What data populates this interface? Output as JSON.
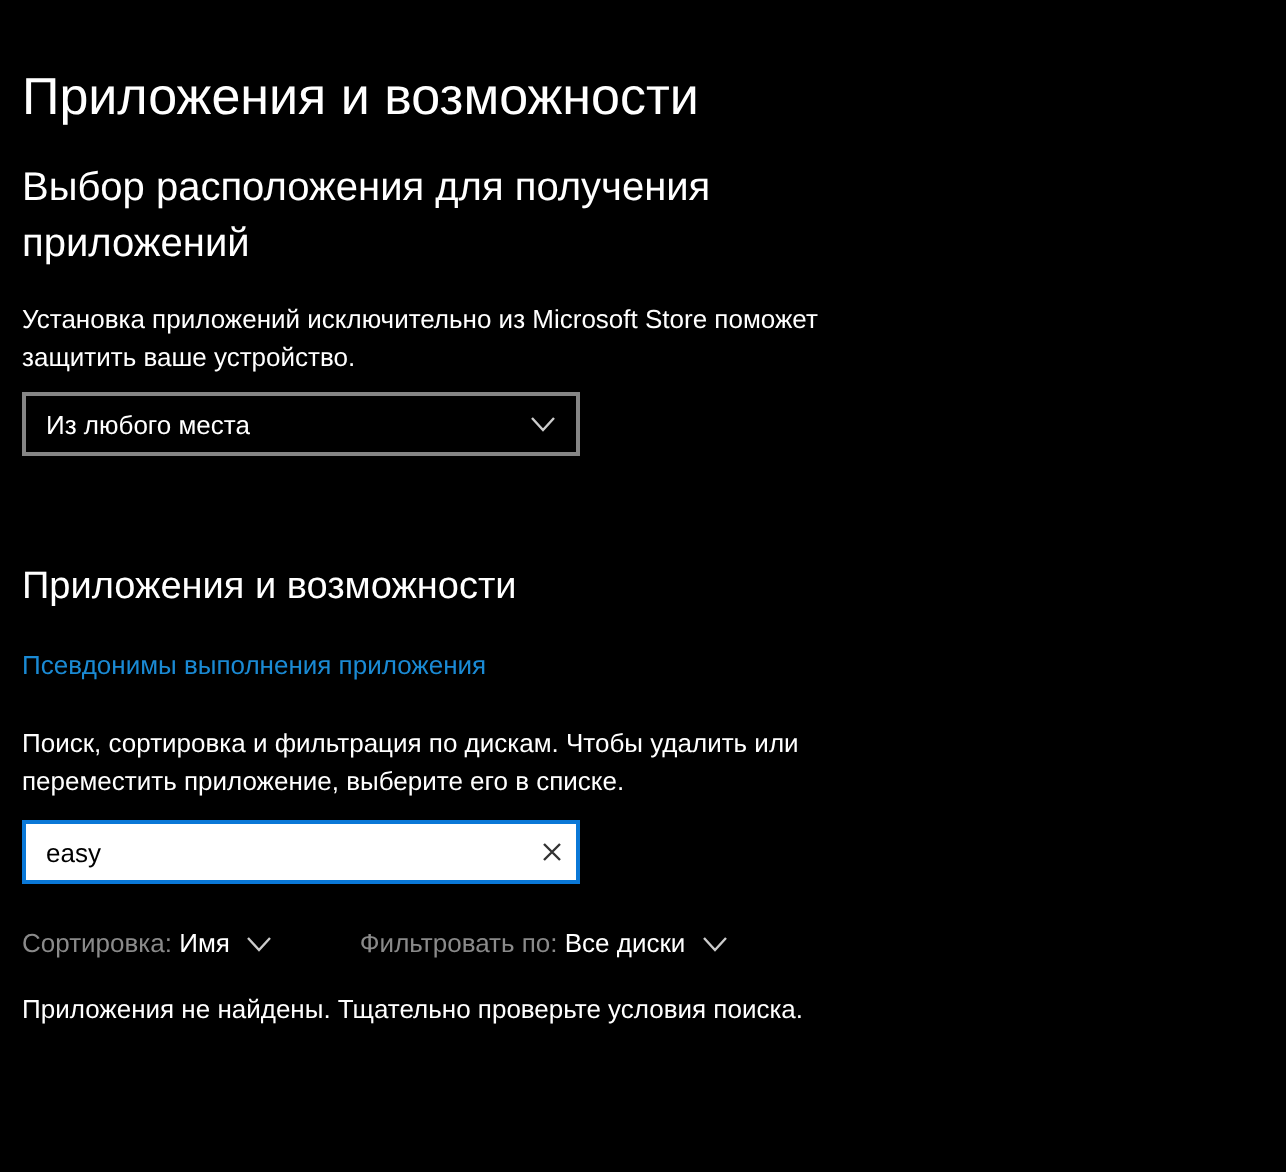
{
  "title": "Приложения и возможности",
  "source": {
    "heading": "Выбор расположения для получения приложений",
    "description": "Установка приложений исключительно из Microsoft Store поможет защитить ваше устройство.",
    "dropdown": {
      "value": "Из любого места"
    }
  },
  "apps": {
    "heading": "Приложения и возможности",
    "link": "Псевдонимы выполнения приложения",
    "description": "Поиск, сортировка и фильтрация по дискам. Чтобы удалить или переместить приложение, выберите его в списке.",
    "search": {
      "value": "easy",
      "focused": true
    },
    "filters": [
      {
        "label": "Сортировка:",
        "value": "Имя"
      },
      {
        "label": "Фильтровать по:",
        "value": "Все диски"
      }
    ],
    "message": "Приложения не найдены. Тщательно проверьте условия поиска."
  }
}
